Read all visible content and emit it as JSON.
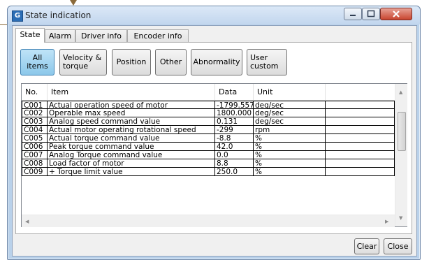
{
  "window": {
    "title": "State indication",
    "app_icon": "G"
  },
  "tabs": [
    {
      "label": "State",
      "active": true
    },
    {
      "label": "Alarm",
      "active": false
    },
    {
      "label": "Driver info",
      "active": false
    },
    {
      "label": "Encoder info",
      "active": false
    }
  ],
  "categories": [
    {
      "label": "All items",
      "active": true
    },
    {
      "label": "Velocity &\ntorque",
      "active": false
    },
    {
      "label": "Position",
      "active": false
    },
    {
      "label": "Other",
      "active": false
    },
    {
      "label": "Abnormality",
      "active": false
    },
    {
      "label": "User\ncustom",
      "active": false
    }
  ],
  "table": {
    "columns": [
      "No.",
      "Item",
      "Data",
      "Unit",
      ""
    ],
    "rows": [
      [
        "C001",
        "Actual operation speed of motor",
        "-1799.557",
        "deg/sec"
      ],
      [
        "C002",
        "Operable max speed",
        "1800.000",
        "deg/sec"
      ],
      [
        "C003",
        "Analog speed command value",
        "0.131",
        "deg/sec"
      ],
      [
        "C004",
        "Actual motor operating rotational speed",
        "-299",
        "rpm"
      ],
      [
        "C005",
        "Actual torque command value",
        "-8.8",
        "%"
      ],
      [
        "C006",
        "Peak torque command value",
        "42.0",
        "%"
      ],
      [
        "C007",
        "Analog Torque command value",
        "0.0",
        "%"
      ],
      [
        "C008",
        "Load factor of motor",
        "8.8",
        "%"
      ],
      [
        "C009",
        "+ Torque limit value",
        "250.0",
        "%"
      ]
    ]
  },
  "buttons": {
    "clear": "Clear",
    "close": "Close"
  },
  "colors": {
    "active_category": "#8cc8ea",
    "title_bar": "#c2d6ee",
    "close_button": "#c8452f"
  }
}
